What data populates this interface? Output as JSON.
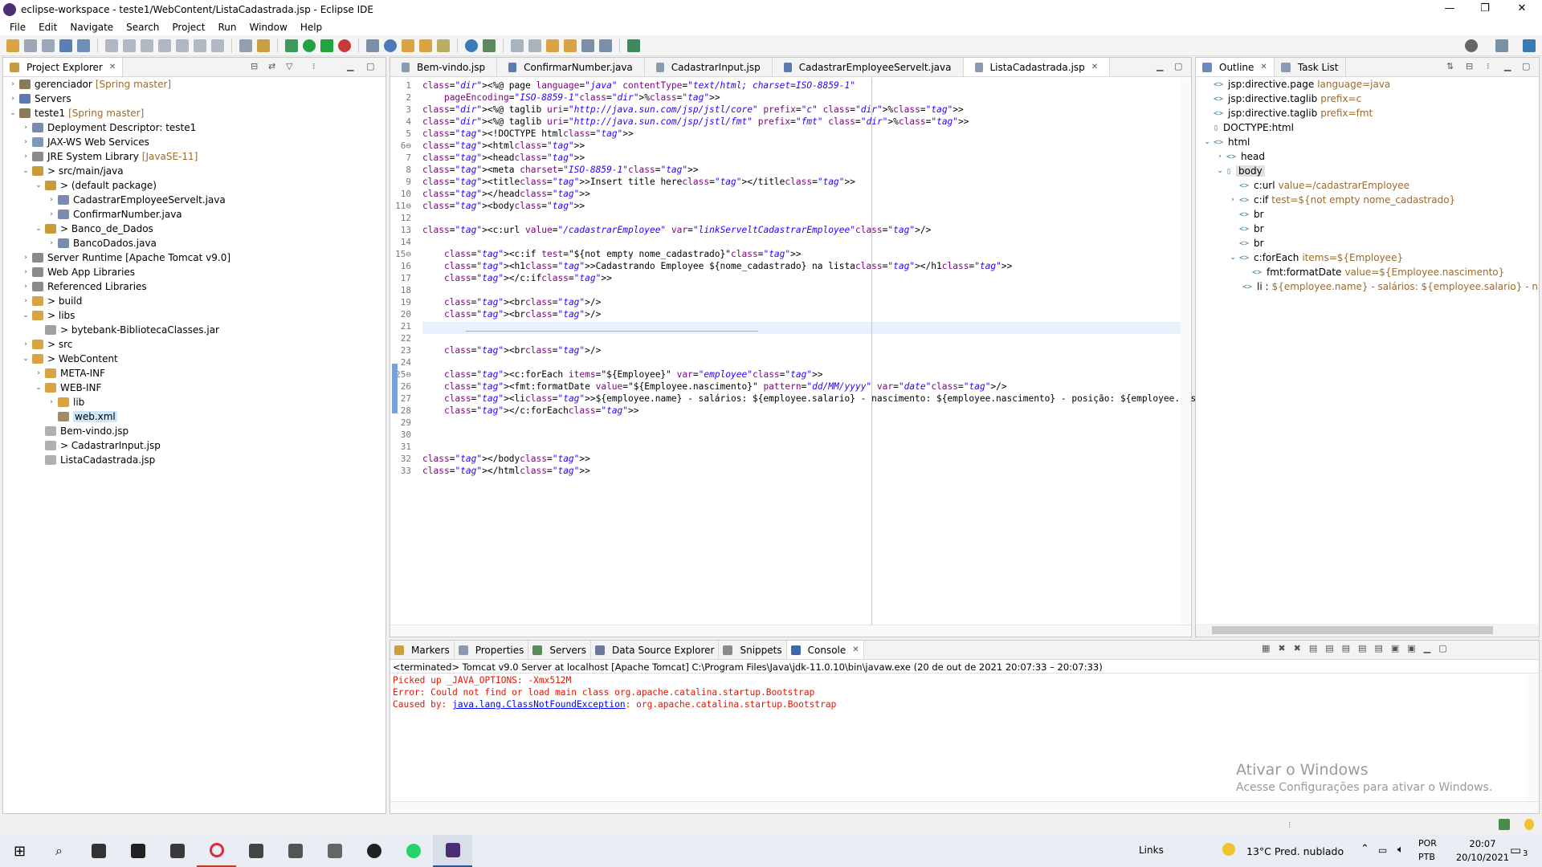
{
  "window": {
    "title": "eclipse-workspace - teste1/WebContent/ListaCadastrada.jsp - Eclipse IDE",
    "minimize": "—",
    "maximize": "❐",
    "close": "✕"
  },
  "menu": [
    "File",
    "Edit",
    "Navigate",
    "Search",
    "Project",
    "Run",
    "Window",
    "Help"
  ],
  "project_explorer": {
    "title": "Project Explorer",
    "items": [
      {
        "label": "gerenciador",
        "deco": "[Spring master]",
        "level": 0,
        "tw": "›"
      },
      {
        "label": "Servers",
        "deco": "",
        "level": 0,
        "tw": "›"
      },
      {
        "label": "teste1",
        "deco": "[Spring master]",
        "level": 0,
        "tw": "⌄"
      },
      {
        "label": "Deployment Descriptor: teste1",
        "deco": "",
        "level": 1,
        "tw": "›"
      },
      {
        "label": "JAX-WS Web Services",
        "deco": "",
        "level": 1,
        "tw": "›"
      },
      {
        "label": "JRE System Library",
        "deco": "[JavaSE-11]",
        "level": 1,
        "tw": "›"
      },
      {
        "label": "> src/main/java",
        "deco": "",
        "level": 1,
        "tw": "⌄"
      },
      {
        "label": "> (default package)",
        "deco": "",
        "level": 2,
        "tw": "⌄"
      },
      {
        "label": "CadastrarEmployeeServelt.java",
        "deco": "",
        "level": 3,
        "tw": "›"
      },
      {
        "label": "ConfirmarNumber.java",
        "deco": "",
        "level": 3,
        "tw": "›"
      },
      {
        "label": "> Banco_de_Dados",
        "deco": "",
        "level": 2,
        "tw": "⌄"
      },
      {
        "label": "BancoDados.java",
        "deco": "",
        "level": 3,
        "tw": "›"
      },
      {
        "label": "Server Runtime [Apache Tomcat v9.0]",
        "deco": "",
        "level": 1,
        "tw": "›"
      },
      {
        "label": "Web App Libraries",
        "deco": "",
        "level": 1,
        "tw": "›"
      },
      {
        "label": "Referenced Libraries",
        "deco": "",
        "level": 1,
        "tw": "›"
      },
      {
        "label": "> build",
        "deco": "",
        "level": 1,
        "tw": "›"
      },
      {
        "label": "> libs",
        "deco": "",
        "level": 1,
        "tw": "⌄"
      },
      {
        "label": "> bytebank-BibliotecaClasses.jar",
        "deco": "",
        "level": 2,
        "tw": ""
      },
      {
        "label": "> src",
        "deco": "",
        "level": 1,
        "tw": "›"
      },
      {
        "label": "> WebContent",
        "deco": "",
        "level": 1,
        "tw": "⌄"
      },
      {
        "label": "META-INF",
        "deco": "",
        "level": 2,
        "tw": "›"
      },
      {
        "label": "WEB-INF",
        "deco": "",
        "level": 2,
        "tw": "⌄"
      },
      {
        "label": "lib",
        "deco": "",
        "level": 3,
        "tw": "›"
      },
      {
        "label": "web.xml",
        "deco": "",
        "level": 3,
        "tw": "",
        "selected": true
      },
      {
        "label": "Bem-vindo.jsp",
        "deco": "",
        "level": 2,
        "tw": ""
      },
      {
        "label": "> CadastrarInput.jsp",
        "deco": "",
        "level": 2,
        "tw": ""
      },
      {
        "label": "ListaCadastrada.jsp",
        "deco": "",
        "level": 2,
        "tw": ""
      }
    ]
  },
  "editor": {
    "tabs": [
      "Bem-vindo.jsp",
      "ConfirmarNumber.java",
      "CadastrarInput.jsp",
      "CadastrarEmployeeServelt.java",
      "ListaCadastrada.jsp"
    ],
    "active_tab": "ListaCadastrada.jsp",
    "line_numbers": [
      "1",
      "2",
      "3",
      "4",
      "5",
      "6⊖",
      "7",
      "8",
      "9",
      "10",
      "11⊖",
      "12",
      "13",
      "14",
      "15⊖",
      "16",
      "17",
      "18",
      "19",
      "20",
      "21",
      "22",
      "23",
      "24",
      "25⊖",
      "26",
      "27",
      "28",
      "29",
      "30",
      "31",
      "32",
      "33"
    ],
    "lines": [
      "<%@ page language=\"java\" contentType=\"text/html; charset=ISO-8859-1\"",
      "    pageEncoding=\"ISO-8859-1\"%>",
      "<%@ taglib uri=\"http://java.sun.com/jsp/jstl/core\" prefix=\"c\" %>",
      "<%@ taglib uri=\"http://java.sun.com/jsp/jstl/fmt\" prefix=\"fmt\" %>",
      "<!DOCTYPE html>",
      "<html>",
      "<head>",
      "<meta charset=\"ISO-8859-1\">",
      "<title>Insert title here</title>",
      "</head>",
      "<body>",
      "",
      "<c:url value=\"/cadastrarEmployee\" var=\"linkServeltCadastrarEmployee\"/>",
      "",
      "    <c:if test=\"${not empty nome_cadastrado}\">",
      "    <h1>Cadastrando Employee ${nome_cadastrado} na lista</h1>",
      "    </c:if>",
      "",
      "    <br/>",
      "    <br/>",
      "        ______________________________________________________",
      "",
      "    <br/>",
      "",
      "    <c:forEach items=\"${Employee}\" var=\"employee\">",
      "    <fmt:formatDate value=\"${Employee.nascimento}\" pattern=\"dd/MM/yyyy\" var=\"date\"/>",
      "    <li>${employee.name} - salários: ${employee.salario} - nascimento: ${employee.nascimento} - posição: ${employee.position}</li>",
      "    </c:forEach>",
      "",
      "",
      "",
      "</body>",
      "</html>"
    ]
  },
  "outline": {
    "tabs": [
      "Outline",
      "Task List"
    ],
    "items": [
      {
        "label": "jsp:directive.page",
        "extra": "language=java",
        "level": 0,
        "tw": ""
      },
      {
        "label": "jsp:directive.taglib",
        "extra": "prefix=c",
        "level": 0,
        "tw": ""
      },
      {
        "label": "jsp:directive.taglib",
        "extra": "prefix=fmt",
        "level": 0,
        "tw": ""
      },
      {
        "label": "DOCTYPE:html",
        "extra": "",
        "level": 0,
        "tw": ""
      },
      {
        "label": "html",
        "extra": "",
        "level": 0,
        "tw": "⌄"
      },
      {
        "label": "head",
        "extra": "",
        "level": 1,
        "tw": "›"
      },
      {
        "label": "body",
        "extra": "",
        "level": 1,
        "tw": "⌄",
        "selected": true
      },
      {
        "label": "c:url",
        "extra": "value=/cadastrarEmployee",
        "level": 2,
        "tw": ""
      },
      {
        "label": "c:if",
        "extra": "test=${not empty nome_cadastrado}",
        "level": 2,
        "tw": "›"
      },
      {
        "label": "br",
        "extra": "",
        "level": 2,
        "tw": ""
      },
      {
        "label": "br",
        "extra": "",
        "level": 2,
        "tw": ""
      },
      {
        "label": "br",
        "extra": "",
        "level": 2,
        "tw": ""
      },
      {
        "label": "c:forEach",
        "extra": "items=${Employee}",
        "level": 2,
        "tw": "⌄"
      },
      {
        "label": "fmt:formatDate",
        "extra": "value=${Employee.nascimento}",
        "level": 3,
        "tw": ""
      },
      {
        "label": "li :",
        "extra": "${employee.name} - salários: ${employee.salario} - nascimen",
        "level": 3,
        "tw": ""
      }
    ]
  },
  "bottom": {
    "tabs": [
      "Markers",
      "Properties",
      "Servers",
      "Data Source Explorer",
      "Snippets",
      "Console"
    ],
    "active_tab": "Console",
    "status": "<terminated> Tomcat v9.0 Server at localhost [Apache Tomcat] C:\\Program Files\\Java\\jdk-11.0.10\\bin\\javaw.exe  (20 de out de 2021 20:07:33 – 20:07:33)",
    "console": {
      "line1": "Picked up _JAVA_OPTIONS: -Xmx512M",
      "line2": "Error: Could not find or load main class org.apache.catalina.startup.Bootstrap",
      "line3_prefix": "Caused by: ",
      "line3_link": "java.lang.ClassNotFoundException",
      "line3_suffix": ": org.apache.catalina.startup.Bootstrap"
    },
    "watermark_title": "Ativar o Windows",
    "watermark_sub": "Acesse Configurações para ativar o Windows."
  },
  "taskbar": {
    "links": "Links",
    "weather": "13°C  Pred. nublado",
    "lang1": "POR",
    "lang2": "PTB",
    "time": "20:07",
    "date": "20/10/2021",
    "notif": "3"
  },
  "colors": {
    "accent": "#2b5797",
    "selection": "#cce8ff",
    "console_error": "#e51400",
    "link": "#0000ff"
  }
}
